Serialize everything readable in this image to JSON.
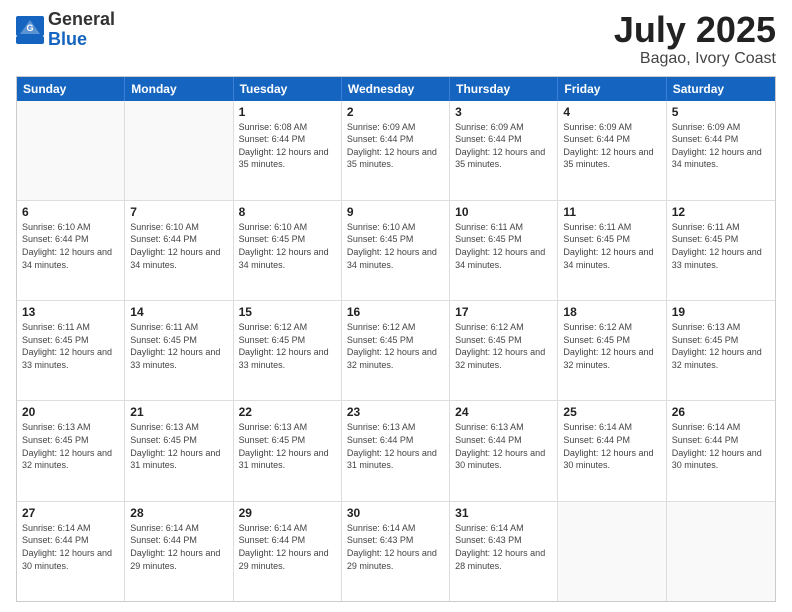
{
  "logo": {
    "general": "General",
    "blue": "Blue"
  },
  "title": "July 2025",
  "subtitle": "Bagao, Ivory Coast",
  "days": [
    "Sunday",
    "Monday",
    "Tuesday",
    "Wednesday",
    "Thursday",
    "Friday",
    "Saturday"
  ],
  "weeks": [
    [
      {
        "day": "",
        "info": ""
      },
      {
        "day": "",
        "info": ""
      },
      {
        "day": "1",
        "info": "Sunrise: 6:08 AM\nSunset: 6:44 PM\nDaylight: 12 hours and 35 minutes."
      },
      {
        "day": "2",
        "info": "Sunrise: 6:09 AM\nSunset: 6:44 PM\nDaylight: 12 hours and 35 minutes."
      },
      {
        "day": "3",
        "info": "Sunrise: 6:09 AM\nSunset: 6:44 PM\nDaylight: 12 hours and 35 minutes."
      },
      {
        "day": "4",
        "info": "Sunrise: 6:09 AM\nSunset: 6:44 PM\nDaylight: 12 hours and 35 minutes."
      },
      {
        "day": "5",
        "info": "Sunrise: 6:09 AM\nSunset: 6:44 PM\nDaylight: 12 hours and 34 minutes."
      }
    ],
    [
      {
        "day": "6",
        "info": "Sunrise: 6:10 AM\nSunset: 6:44 PM\nDaylight: 12 hours and 34 minutes."
      },
      {
        "day": "7",
        "info": "Sunrise: 6:10 AM\nSunset: 6:44 PM\nDaylight: 12 hours and 34 minutes."
      },
      {
        "day": "8",
        "info": "Sunrise: 6:10 AM\nSunset: 6:45 PM\nDaylight: 12 hours and 34 minutes."
      },
      {
        "day": "9",
        "info": "Sunrise: 6:10 AM\nSunset: 6:45 PM\nDaylight: 12 hours and 34 minutes."
      },
      {
        "day": "10",
        "info": "Sunrise: 6:11 AM\nSunset: 6:45 PM\nDaylight: 12 hours and 34 minutes."
      },
      {
        "day": "11",
        "info": "Sunrise: 6:11 AM\nSunset: 6:45 PM\nDaylight: 12 hours and 34 minutes."
      },
      {
        "day": "12",
        "info": "Sunrise: 6:11 AM\nSunset: 6:45 PM\nDaylight: 12 hours and 33 minutes."
      }
    ],
    [
      {
        "day": "13",
        "info": "Sunrise: 6:11 AM\nSunset: 6:45 PM\nDaylight: 12 hours and 33 minutes."
      },
      {
        "day": "14",
        "info": "Sunrise: 6:11 AM\nSunset: 6:45 PM\nDaylight: 12 hours and 33 minutes."
      },
      {
        "day": "15",
        "info": "Sunrise: 6:12 AM\nSunset: 6:45 PM\nDaylight: 12 hours and 33 minutes."
      },
      {
        "day": "16",
        "info": "Sunrise: 6:12 AM\nSunset: 6:45 PM\nDaylight: 12 hours and 32 minutes."
      },
      {
        "day": "17",
        "info": "Sunrise: 6:12 AM\nSunset: 6:45 PM\nDaylight: 12 hours and 32 minutes."
      },
      {
        "day": "18",
        "info": "Sunrise: 6:12 AM\nSunset: 6:45 PM\nDaylight: 12 hours and 32 minutes."
      },
      {
        "day": "19",
        "info": "Sunrise: 6:13 AM\nSunset: 6:45 PM\nDaylight: 12 hours and 32 minutes."
      }
    ],
    [
      {
        "day": "20",
        "info": "Sunrise: 6:13 AM\nSunset: 6:45 PM\nDaylight: 12 hours and 32 minutes."
      },
      {
        "day": "21",
        "info": "Sunrise: 6:13 AM\nSunset: 6:45 PM\nDaylight: 12 hours and 31 minutes."
      },
      {
        "day": "22",
        "info": "Sunrise: 6:13 AM\nSunset: 6:45 PM\nDaylight: 12 hours and 31 minutes."
      },
      {
        "day": "23",
        "info": "Sunrise: 6:13 AM\nSunset: 6:44 PM\nDaylight: 12 hours and 31 minutes."
      },
      {
        "day": "24",
        "info": "Sunrise: 6:13 AM\nSunset: 6:44 PM\nDaylight: 12 hours and 30 minutes."
      },
      {
        "day": "25",
        "info": "Sunrise: 6:14 AM\nSunset: 6:44 PM\nDaylight: 12 hours and 30 minutes."
      },
      {
        "day": "26",
        "info": "Sunrise: 6:14 AM\nSunset: 6:44 PM\nDaylight: 12 hours and 30 minutes."
      }
    ],
    [
      {
        "day": "27",
        "info": "Sunrise: 6:14 AM\nSunset: 6:44 PM\nDaylight: 12 hours and 30 minutes."
      },
      {
        "day": "28",
        "info": "Sunrise: 6:14 AM\nSunset: 6:44 PM\nDaylight: 12 hours and 29 minutes."
      },
      {
        "day": "29",
        "info": "Sunrise: 6:14 AM\nSunset: 6:44 PM\nDaylight: 12 hours and 29 minutes."
      },
      {
        "day": "30",
        "info": "Sunrise: 6:14 AM\nSunset: 6:43 PM\nDaylight: 12 hours and 29 minutes."
      },
      {
        "day": "31",
        "info": "Sunrise: 6:14 AM\nSunset: 6:43 PM\nDaylight: 12 hours and 28 minutes."
      },
      {
        "day": "",
        "info": ""
      },
      {
        "day": "",
        "info": ""
      }
    ]
  ]
}
